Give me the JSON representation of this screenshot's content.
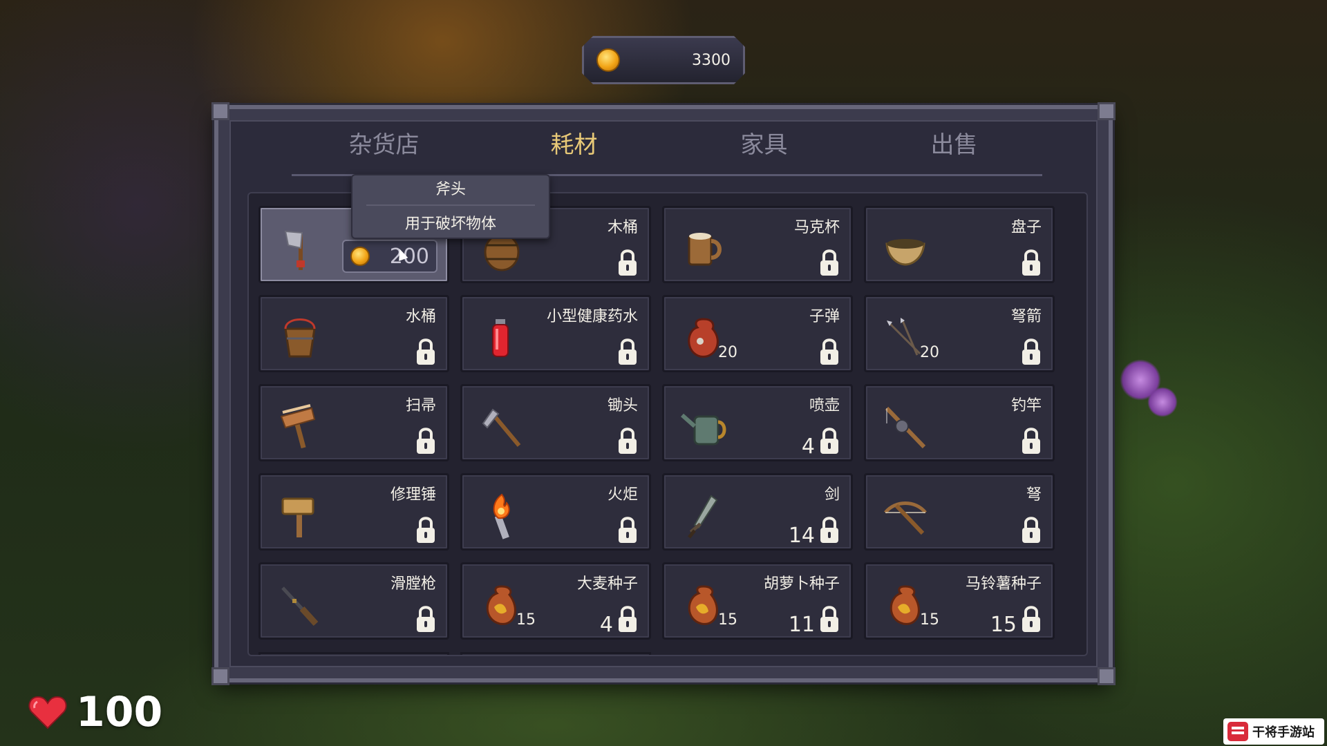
{
  "hud": {
    "gold": "3300",
    "health": "100"
  },
  "tabs": [
    {
      "label": "杂货店"
    },
    {
      "label": "耗材"
    },
    {
      "label": "家具"
    },
    {
      "label": "出售"
    }
  ],
  "active_tab": "耗材",
  "tooltip": {
    "title": "斧头",
    "description": "用于破坏物体"
  },
  "hovered_item": {
    "price": "200"
  },
  "items": [
    {
      "name": "",
      "icon": "axe-icon",
      "qty": "",
      "stock": ""
    },
    {
      "name": "木桶",
      "icon": "barrel-icon",
      "qty": "",
      "stock": ""
    },
    {
      "name": "马克杯",
      "icon": "mug-icon",
      "qty": "",
      "stock": ""
    },
    {
      "name": "盘子",
      "icon": "bowl-icon",
      "qty": "",
      "stock": ""
    },
    {
      "name": "水桶",
      "icon": "bucket-icon",
      "qty": "",
      "stock": ""
    },
    {
      "name": "小型健康药水",
      "icon": "potion-icon",
      "qty": "",
      "stock": ""
    },
    {
      "name": "子弹",
      "icon": "ammo-bag-icon",
      "qty": "20",
      "stock": ""
    },
    {
      "name": "弩箭",
      "icon": "bolts-icon",
      "qty": "20",
      "stock": ""
    },
    {
      "name": "扫帚",
      "icon": "broom-icon",
      "qty": "",
      "stock": ""
    },
    {
      "name": "锄头",
      "icon": "hoe-icon",
      "qty": "",
      "stock": ""
    },
    {
      "name": "喷壶",
      "icon": "watering-can-icon",
      "qty": "",
      "stock": "4"
    },
    {
      "name": "钓竿",
      "icon": "fishing-rod-icon",
      "qty": "",
      "stock": ""
    },
    {
      "name": "修理锤",
      "icon": "hammer-icon",
      "qty": "",
      "stock": ""
    },
    {
      "name": "火炬",
      "icon": "torch-icon",
      "qty": "",
      "stock": ""
    },
    {
      "name": "剑",
      "icon": "sword-icon",
      "qty": "",
      "stock": "14"
    },
    {
      "name": "弩",
      "icon": "crossbow-icon",
      "qty": "",
      "stock": ""
    },
    {
      "name": "滑膛枪",
      "icon": "musket-icon",
      "qty": "",
      "stock": ""
    },
    {
      "name": "大麦种子",
      "icon": "seed-bag-icon",
      "qty": "15",
      "stock": "4"
    },
    {
      "name": "胡萝卜种子",
      "icon": "seed-bag-icon",
      "qty": "15",
      "stock": "11"
    },
    {
      "name": "马铃薯种子",
      "icon": "seed-bag-icon",
      "qty": "15",
      "stock": "15"
    }
  ],
  "watermark": "干将手游站",
  "colors": {
    "active_tab": "#e8c977",
    "inactive_tab": "#8b8a9c",
    "panel": "#3c3b4d",
    "slot": "#2e2d3c",
    "health_heart": "#e8303f"
  }
}
